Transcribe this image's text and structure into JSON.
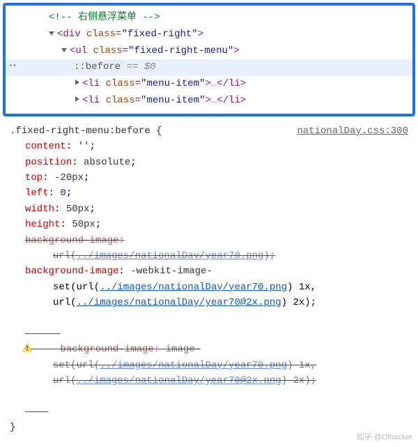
{
  "dom": {
    "comment": "<!-- 右侧悬浮菜单 -->",
    "div_tag": "div",
    "div_class": "fixed-right",
    "ul_tag": "ul",
    "ul_class": "fixed-right-menu",
    "pseudo_before": "::before",
    "equals": "==",
    "dollar": "$0",
    "li_tag": "li",
    "li_class": "menu-item",
    "ellipsis": "…"
  },
  "styles": {
    "selector": ".fixed-right-menu:before {",
    "source_link": "nationalDay.css:300",
    "close_brace": "}",
    "rules": {
      "content_name": "content",
      "content_val": "''",
      "position_name": "position",
      "position_val": "absolute",
      "top_name": "top",
      "top_val": "-20px",
      "left_name": "left",
      "left_val": "0",
      "width_name": "width",
      "width_val": "50px",
      "height_name": "height",
      "height_val": "50px",
      "bg1_name": "background-image",
      "bg1_url": "../images/nationalDay/year70.png",
      "bg2_name": "background-image",
      "bg2_prefix": "-webkit-image-",
      "bg2_set": "set(url(",
      "bg2_url1": "../images/nationalDay/year70.png",
      "bg2_1x": ") 1x,",
      "bg2_url2_prefix": "url(",
      "bg2_url2": "../images/nationalDay/year70@2x.png",
      "bg2_2x": ") 2x);",
      "bg3_name": "background-image",
      "bg3_prefix": "image-",
      "bg3_set": "set(url(",
      "bg3_url1": "../images/nationalDay/year70.png",
      "bg3_1x": ") 1x,",
      "bg3_url2_prefix": "url(",
      "bg3_url2": "../images/nationalDay/year70@2x.png",
      "bg3_2x": ") 2x);"
    }
  },
  "watermark": "知乎 @Olhacker"
}
